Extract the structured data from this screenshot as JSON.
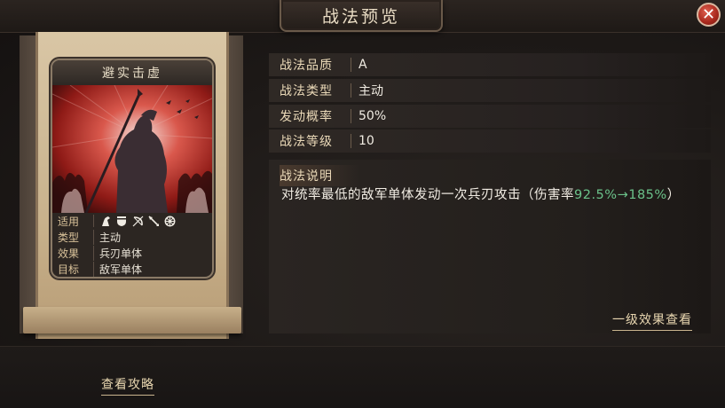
{
  "window": {
    "title": "战法预览",
    "close_icon": "close-icon"
  },
  "card": {
    "name": "避实击虚",
    "rows": [
      {
        "key": "适用",
        "icons": [
          "cavalry-icon",
          "shield-icon",
          "bow-icon",
          "spear-icon",
          "chariot-icon"
        ]
      },
      {
        "key": "类型",
        "value": "主动"
      },
      {
        "key": "效果",
        "value": "兵刃单体"
      },
      {
        "key": "目标",
        "value": "敌军单体"
      }
    ]
  },
  "fields": [
    {
      "label": "战法品质",
      "value": "A"
    },
    {
      "label": "战法类型",
      "value": "主动"
    },
    {
      "label": "发动概率",
      "value": "50%"
    },
    {
      "label": "战法等级",
      "value": "10"
    }
  ],
  "description": {
    "title": "战法说明",
    "text_before": "对统率最低的敌军单体发动一次兵刃攻击（伤害率",
    "text_highlight": "92.5%→185%",
    "text_after": "）"
  },
  "links": {
    "level1_effects": "一级效果查看",
    "view_guide": "查看攻略"
  },
  "colors": {
    "highlight": "#6bc28a",
    "accent": "#ead9b8",
    "close": "#c0392b"
  }
}
